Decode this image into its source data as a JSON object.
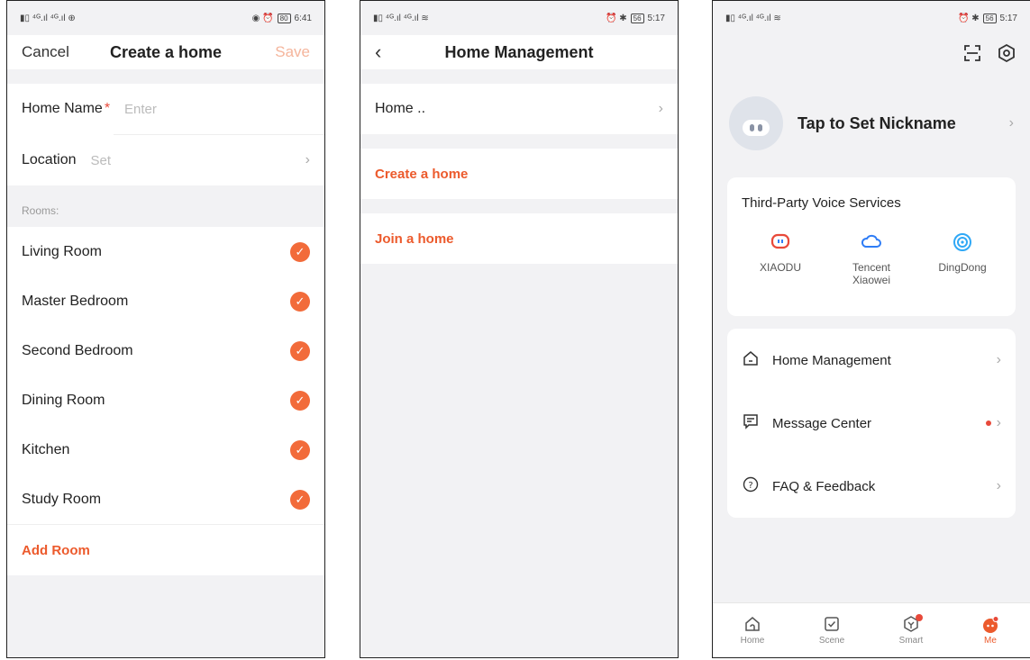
{
  "colors": {
    "accent": "#ec5a2c",
    "check": "#f26b3a",
    "save_disabled": "#f5b59c"
  },
  "screens": {
    "create_home": {
      "status": {
        "left": "▮▯ ⁴ᴳ.ıl ⁴ᴳ.ıl ⊕",
        "right_icons": "◉ ⏰",
        "battery": "80",
        "time": "6:41"
      },
      "header": {
        "cancel": "Cancel",
        "title": "Create a home",
        "save": "Save"
      },
      "home_name_label": "Home Name",
      "required": "*",
      "home_name_placeholder": "Enter",
      "location_label": "Location",
      "location_placeholder": "Set",
      "rooms_label": "Rooms:",
      "rooms": [
        {
          "name": "Living Room",
          "checked": true
        },
        {
          "name": "Master Bedroom",
          "checked": true
        },
        {
          "name": "Second Bedroom",
          "checked": true
        },
        {
          "name": "Dining Room",
          "checked": true
        },
        {
          "name": "Kitchen",
          "checked": true
        },
        {
          "name": "Study Room",
          "checked": true
        }
      ],
      "add_room": "Add Room"
    },
    "home_management": {
      "status": {
        "left": "▮▯ ⁴ᴳ.ıl ⁴ᴳ.ıl ≋",
        "right_icons": "⏰ ✱",
        "battery": "56",
        "time": "5:17"
      },
      "header": {
        "back": "‹",
        "title": "Home Management"
      },
      "home_item": "Home ..",
      "create": "Create a home",
      "join": "Join a home"
    },
    "me": {
      "status": {
        "left": "▮▯ ⁴ᴳ.ıl ⁴ᴳ.ıl ≋",
        "right_icons": "⏰ ✱",
        "battery": "56",
        "time": "5:17"
      },
      "icons": {
        "scan": "scan-icon",
        "settings": "settings-icon"
      },
      "nickname": "Tap to Set Nickname",
      "voice": {
        "title": "Third-Party Voice Services",
        "services": [
          {
            "name": "XIAODU",
            "icon": "xiaodu-icon",
            "color": "#e8493a"
          },
          {
            "name": "Tencent Xiaowei",
            "icon": "cloud-icon",
            "color": "#2f7df6"
          },
          {
            "name": "DingDong",
            "icon": "dingdong-icon",
            "color": "#2fa8f6"
          }
        ]
      },
      "menu": [
        {
          "label": "Home Management",
          "icon": "home-icon"
        },
        {
          "label": "Message Center",
          "icon": "message-icon",
          "dot": true
        },
        {
          "label": "FAQ & Feedback",
          "icon": "question-icon"
        }
      ],
      "tabs": [
        {
          "label": "Home",
          "active": false
        },
        {
          "label": "Scene",
          "active": false
        },
        {
          "label": "Smart",
          "active": false,
          "dot": true
        },
        {
          "label": "Me",
          "active": true
        }
      ]
    }
  }
}
